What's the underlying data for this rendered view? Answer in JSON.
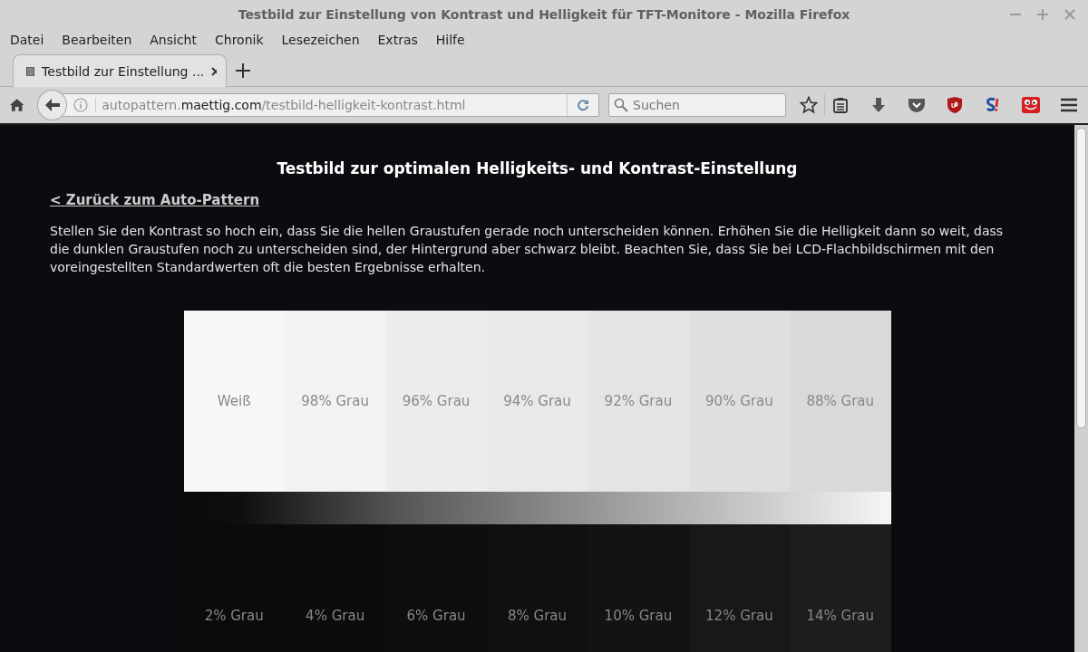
{
  "window": {
    "title": "Testbild zur Einstellung von Kontrast und Helligkeit für TFT-Monitore - Mozilla Firefox"
  },
  "menu": [
    {
      "label": "Datei"
    },
    {
      "label": "Bearbeiten"
    },
    {
      "label": "Ansicht"
    },
    {
      "label": "Chronik"
    },
    {
      "label": "Lesezeichen"
    },
    {
      "label": "Extras"
    },
    {
      "label": "Hilfe"
    }
  ],
  "tabs": [
    {
      "title": "Testbild zur Einstellung ...",
      "selected": true
    }
  ],
  "toolbar": {
    "url_host_pre": "autopattern.",
    "url_host": "maettig.com",
    "url_path": "/testbild-helligkeit-kontrast.html",
    "search_placeholder": "Suchen"
  },
  "page": {
    "heading": "Testbild zur optimalen Helligkeits- und Kontrast-Einstellung",
    "back_link": "< Zurück zum Auto-Pattern",
    "paragraph": "Stellen Sie den Kontrast so hoch ein, dass Sie die hellen Graustufen gerade noch unterscheiden können. Erhöhen Sie die Helligkeit dann so weit, dass die dunklen Graustufen noch zu unterscheiden sind, der Hintergrund aber schwarz bleibt. Beachten Sie, dass Sie bei LCD-Flachbildschirmen mit den voreingestellten Standardwerten oft die besten Ergebnisse erhalten.",
    "light_swatches": [
      {
        "label": "Weiß",
        "color": "#f7f7f7"
      },
      {
        "label": "98% Grau",
        "color": "#f2f2f2"
      },
      {
        "label": "96% Grau",
        "color": "#ececec"
      },
      {
        "label": "94% Grau",
        "color": "#e9e9e9"
      },
      {
        "label": "92% Grau",
        "color": "#e4e4e4"
      },
      {
        "label": "90% Grau",
        "color": "#dfdfdf"
      },
      {
        "label": "88% Grau",
        "color": "#d9d9d9"
      }
    ],
    "dark_swatches": [
      {
        "label": "2% Grau",
        "color": "#0b0b0b"
      },
      {
        "label": "4% Grau",
        "color": "#0c0c0c"
      },
      {
        "label": "6% Grau",
        "color": "#0e0e0e"
      },
      {
        "label": "8% Grau",
        "color": "#101010"
      },
      {
        "label": "10% Grau",
        "color": "#131313"
      },
      {
        "label": "12% Grau",
        "color": "#181818"
      },
      {
        "label": "14% Grau",
        "color": "#1d1d1d"
      }
    ]
  }
}
